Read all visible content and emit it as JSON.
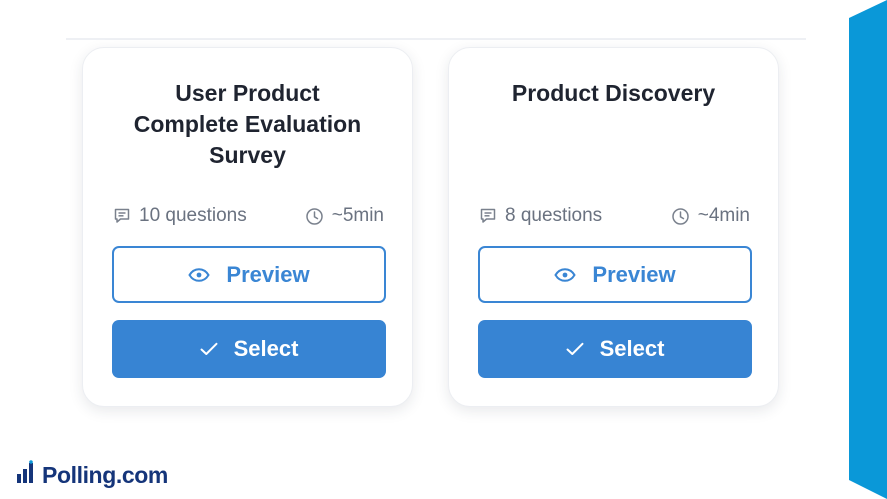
{
  "brand": {
    "name": "Polling.com",
    "accent_color": "#3784d3",
    "ribbon_color": "#0a98d8"
  },
  "cards": [
    {
      "title_lines": [
        "User Product",
        "Complete Evaluation",
        "Survey"
      ],
      "questions": "10 questions",
      "duration": "~5min",
      "preview_label": "Preview",
      "select_label": "Select"
    },
    {
      "title_lines": [
        "Product Discovery"
      ],
      "questions": "8 questions",
      "duration": "~4min",
      "preview_label": "Preview",
      "select_label": "Select"
    }
  ],
  "icons": {
    "questions": "chat-bubble-icon",
    "duration": "clock-icon",
    "preview": "eye-icon",
    "select": "check-icon",
    "logo": "bar-chart-logo-icon"
  }
}
